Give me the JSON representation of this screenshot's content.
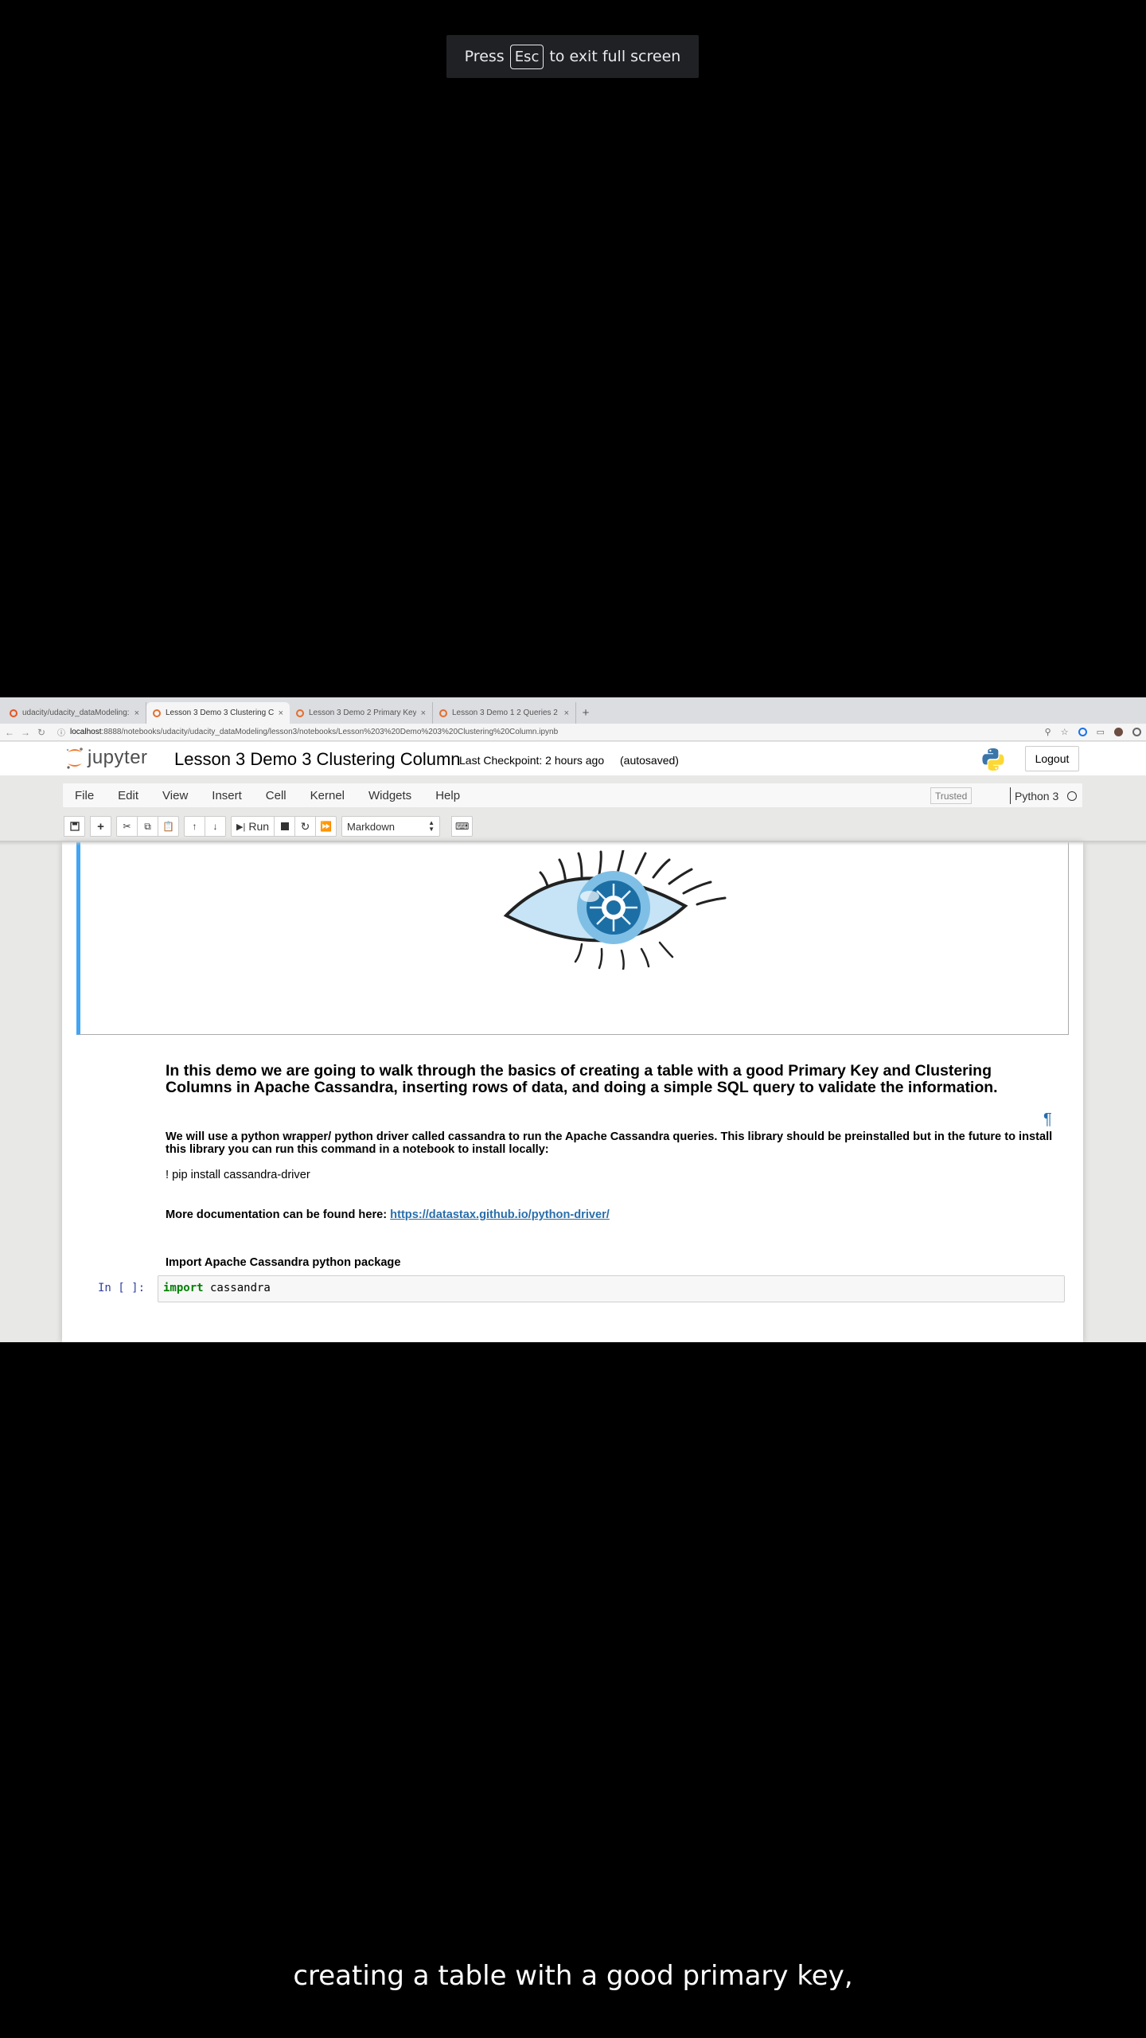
{
  "fullscreen_toast": {
    "before": "Press",
    "key": "Esc",
    "after": "to exit full screen"
  },
  "browser": {
    "tabs": [
      {
        "label": "udacity/udacity_dataModeling:",
        "active": false
      },
      {
        "label": "Lesson 3 Demo 3 Clustering C",
        "active": true
      },
      {
        "label": "Lesson 3 Demo 2 Primary Key",
        "active": false
      },
      {
        "label": "Lesson 3 Demo 1 2 Queries 2 T",
        "active": false
      }
    ],
    "tab_close": "×",
    "new_tab": "+",
    "url_host": "localhost",
    "url_rest": ":8888/notebooks/udacity/udacity_dataModeling/lesson3/notebooks/Lesson%203%20Demo%203%20Clustering%20Column.ipynb"
  },
  "jupyter": {
    "logo_text": "jupyter",
    "notebook_title": "Lesson 3 Demo 3 Clustering Column",
    "checkpoint": "Last Checkpoint: 2 hours ago",
    "autosave": "(autosaved)",
    "logout_label": "Logout",
    "menu": [
      "File",
      "Edit",
      "View",
      "Insert",
      "Cell",
      "Kernel",
      "Widgets",
      "Help"
    ],
    "trusted_label": "Trusted",
    "kernel_name": "Python 3",
    "run_label": "Run",
    "cell_type": "Markdown"
  },
  "notebook": {
    "heading": "In this demo we are going to walk through the basics of creating a table with a good Primary Key and Clustering Columns in Apache Cassandra, inserting rows of data, and doing a simple SQL query to validate the information.",
    "pilcrow": "¶",
    "driver_note": "We will use a python wrapper/ python driver called cassandra to run the Apache Cassandra queries. This library should be preinstalled but in the future to install this library you can run this command in a notebook to install locally:",
    "pip_command": "! pip install cassandra-driver",
    "docs_prefix": "More documentation can be found here: ",
    "docs_link": "https://datastax.github.io/python-driver/",
    "import_heading": "Import Apache Cassandra python package",
    "code_prompt": "In [ ]:",
    "code_keyword": "import",
    "code_module": " cassandra"
  },
  "subtitle": "creating a table with a good primary key,",
  "colors": {
    "selected_cell_border": "#42a5f5",
    "link": "#296eaa",
    "prompt": "#303f9f",
    "keyword": "#008000"
  }
}
